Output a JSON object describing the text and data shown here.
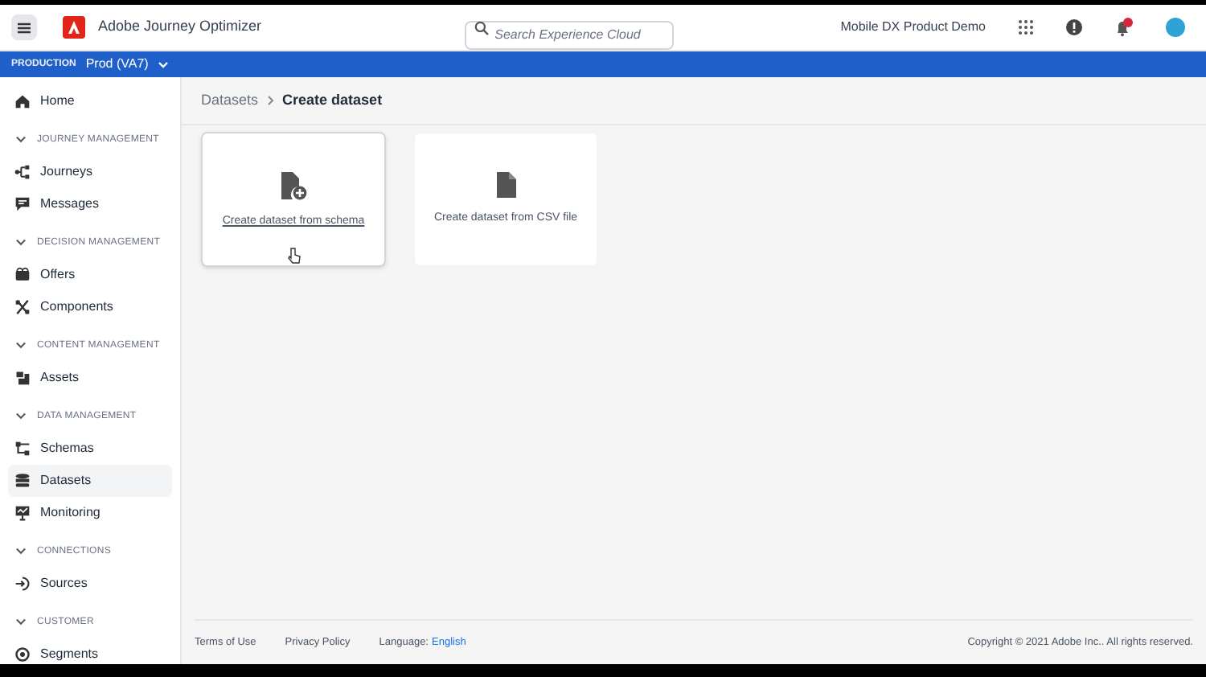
{
  "header": {
    "app_name": "Adobe Journey Optimizer",
    "search": {
      "placeholder": "Search Experience Cloud"
    },
    "org_name": "Mobile DX Product Demo"
  },
  "environment_bar": {
    "label": "PRODUCTION",
    "sandbox": "Prod (VA7)"
  },
  "sidebar": {
    "items": [
      {
        "kind": "item",
        "label": "Home",
        "selected": false
      },
      {
        "kind": "section",
        "label": "JOURNEY MANAGEMENT",
        "expanded": true
      },
      {
        "kind": "item",
        "label": "Journeys",
        "selected": false
      },
      {
        "kind": "item",
        "label": "Messages",
        "selected": false
      },
      {
        "kind": "section",
        "label": "DECISION MANAGEMENT",
        "expanded": true
      },
      {
        "kind": "item",
        "label": "Offers",
        "selected": false
      },
      {
        "kind": "item",
        "label": "Components",
        "selected": false
      },
      {
        "kind": "section",
        "label": "CONTENT MANAGEMENT",
        "expanded": true
      },
      {
        "kind": "item",
        "label": "Assets",
        "selected": false
      },
      {
        "kind": "section",
        "label": "DATA MANAGEMENT",
        "expanded": true
      },
      {
        "kind": "item",
        "label": "Schemas",
        "selected": false
      },
      {
        "kind": "item",
        "label": "Datasets",
        "selected": true
      },
      {
        "kind": "item",
        "label": "Monitoring",
        "selected": false
      },
      {
        "kind": "section",
        "label": "CONNECTIONS",
        "expanded": true
      },
      {
        "kind": "item",
        "label": "Sources",
        "selected": false
      },
      {
        "kind": "section",
        "label": "CUSTOMER",
        "expanded": true
      },
      {
        "kind": "item",
        "label": "Segments",
        "selected": false
      }
    ]
  },
  "breadcrumb": [
    {
      "label": "Datasets",
      "current": false
    },
    {
      "label": "Create dataset",
      "current": true
    }
  ],
  "cards": [
    {
      "kind": "schema",
      "label": "Create dataset from schema",
      "hovered": true
    },
    {
      "kind": "csv",
      "label": "Create dataset from CSV file",
      "hovered": false
    }
  ],
  "footer": {
    "links": [
      "Terms of Use",
      "Privacy Policy"
    ],
    "language_label": "Language:",
    "language": "English",
    "copyright": "Copyright © 2021 Adobe Inc.. All rights reserved."
  }
}
